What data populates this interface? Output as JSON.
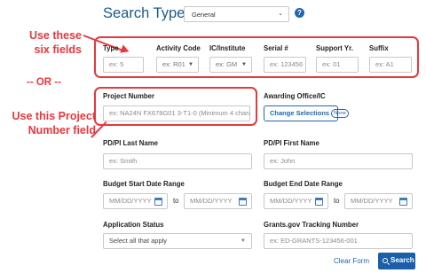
{
  "header": {
    "title": "Search Type:",
    "search_type_value": "General",
    "help_icon": "?"
  },
  "annotations": {
    "six_fields_line1": "Use these",
    "six_fields_line2": "six fields",
    "or": "-- OR --",
    "pn_line1": "Use this Project",
    "pn_line2": "Number field",
    "color": "#e8383d"
  },
  "grant_fields": {
    "type": {
      "label": "Type",
      "placeholder": "ex: 5"
    },
    "activity_code": {
      "label": "Activity Code",
      "value": "ex: R01"
    },
    "ic_institute": {
      "label": "IC/Institute",
      "value": "ex: GM"
    },
    "serial": {
      "label": "Serial #",
      "placeholder": "ex: 123456"
    },
    "support_yr": {
      "label": "Support Yr.",
      "placeholder": "ex: 01"
    },
    "suffix": {
      "label": "Suffix",
      "placeholder": "ex: A1"
    }
  },
  "project_number": {
    "label": "Project Number",
    "placeholder": "ex: NA24N FX678G01 3-T1-0 (Minimum 4 charac"
  },
  "awarding_office": {
    "label": "Awarding Office/IC",
    "button_label": "Change Selections",
    "badge": "None"
  },
  "pi_last": {
    "label": "PD/PI Last Name",
    "placeholder": "ex: Smith"
  },
  "pi_first": {
    "label": "PD/PI First Name",
    "placeholder": "ex: John"
  },
  "budget_start": {
    "label": "Budget Start Date Range",
    "from_placeholder": "MM/DD/YYYY",
    "to_text": "to",
    "to_placeholder": "MM/DD/YYYY"
  },
  "budget_end": {
    "label": "Budget End Date Range",
    "from_placeholder": "MM/DD/YYYY",
    "to_text": "to",
    "to_placeholder": "MM/DD/YYYY"
  },
  "app_status": {
    "label": "Application Status",
    "value": "Select all that apply"
  },
  "grants_gov": {
    "label": "Grants.gov Tracking Number",
    "placeholder": "ex: ED-GRANTS-123456-001"
  },
  "actions": {
    "clear_label": "Clear Form",
    "search_label": "Search"
  }
}
